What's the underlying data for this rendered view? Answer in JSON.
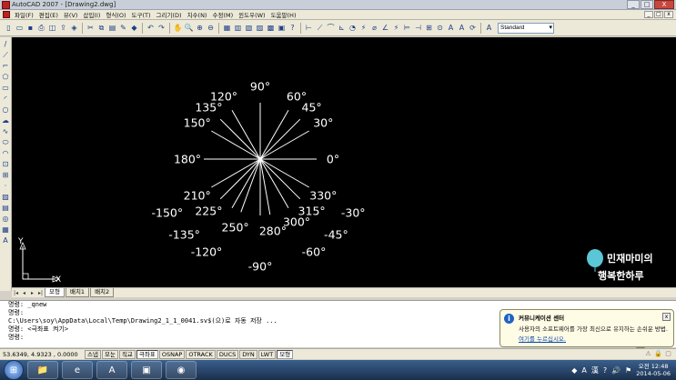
{
  "window": {
    "title": "AutoCAD 2007 - [Drawing2.dwg]",
    "buttons": [
      "_",
      "□",
      "X"
    ]
  },
  "menubar": {
    "items": [
      "파일(F)",
      "편집(E)",
      "뷰(V)",
      "삽입(I)",
      "형식(O)",
      "도구(T)",
      "그리기(D)",
      "치수(N)",
      "수정(M)",
      "윈도우(W)",
      "도움말(H)"
    ],
    "mdi_buttons": [
      "_",
      "□",
      "x"
    ]
  },
  "toolbar": {
    "text_style": "Standard"
  },
  "drawing": {
    "angle_labels": [
      {
        "text": "90°",
        "angle": 90
      },
      {
        "text": "120°",
        "angle": 120
      },
      {
        "text": "60°",
        "angle": 60
      },
      {
        "text": "135°",
        "angle": 135
      },
      {
        "text": "45°",
        "angle": 45
      },
      {
        "text": "150°",
        "angle": 150
      },
      {
        "text": "30°",
        "angle": 30
      },
      {
        "text": "180°",
        "angle": 180
      },
      {
        "text": "0°",
        "angle": 0
      },
      {
        "text": "210°",
        "angle": 210
      },
      {
        "text": "-150°",
        "angle": 210
      },
      {
        "text": "330°",
        "angle": 330
      },
      {
        "text": "-30°",
        "angle": 330
      },
      {
        "text": "225°",
        "angle": 225
      },
      {
        "text": "-135°",
        "angle": 225
      },
      {
        "text": "315°",
        "angle": 315
      },
      {
        "text": "-45°",
        "angle": 315
      },
      {
        "text": "250°",
        "angle": 250
      },
      {
        "text": "-120°",
        "angle": 240
      },
      {
        "text": "300°",
        "angle": 300
      },
      {
        "text": "-60°",
        "angle": 300
      },
      {
        "text": "280°",
        "angle": 280
      },
      {
        "text": "-90°",
        "angle": 270
      }
    ],
    "ucs_x": "X",
    "ucs_y": "Y"
  },
  "watermark": {
    "line1": "민재마미의",
    "line2": "행복한하루"
  },
  "tabs": {
    "items": [
      "모형",
      "배치1",
      "배치2"
    ],
    "active": 0
  },
  "command_lines": [
    "명령: _qnew",
    "명령:",
    "C:\\Users\\soy\\AppData\\Local\\Temp\\Drawing2_1_1_0041.sv$(으)로 자동 저장 ...",
    "명령: <극좌표 켜기>",
    "명령:"
  ],
  "status": {
    "coords": "53.6349, 4.9323 , 0.0000",
    "buttons": [
      {
        "label": "스냅",
        "on": false
      },
      {
        "label": "모눈",
        "on": false
      },
      {
        "label": "직교",
        "on": false
      },
      {
        "label": "극좌표",
        "on": true
      },
      {
        "label": "OSNAP",
        "on": false
      },
      {
        "label": "OTRACK",
        "on": false
      },
      {
        "label": "DUCS",
        "on": false
      },
      {
        "label": "DYN",
        "on": false
      },
      {
        "label": "LWT",
        "on": false
      },
      {
        "label": "모형",
        "on": true
      }
    ]
  },
  "notification": {
    "title": "커뮤니케이션 센터",
    "body": "사용자의 소프트웨어를 가장 최신으로 유지하는 손쉬운 방법.",
    "link": "여기를 누르십시오."
  },
  "taskbar": {
    "time": "오전 12:48",
    "date": "2014-05-06"
  },
  "colors": {
    "canvas_bg": "#000000",
    "line": "#ffffff",
    "accent": "#1e62c4"
  }
}
